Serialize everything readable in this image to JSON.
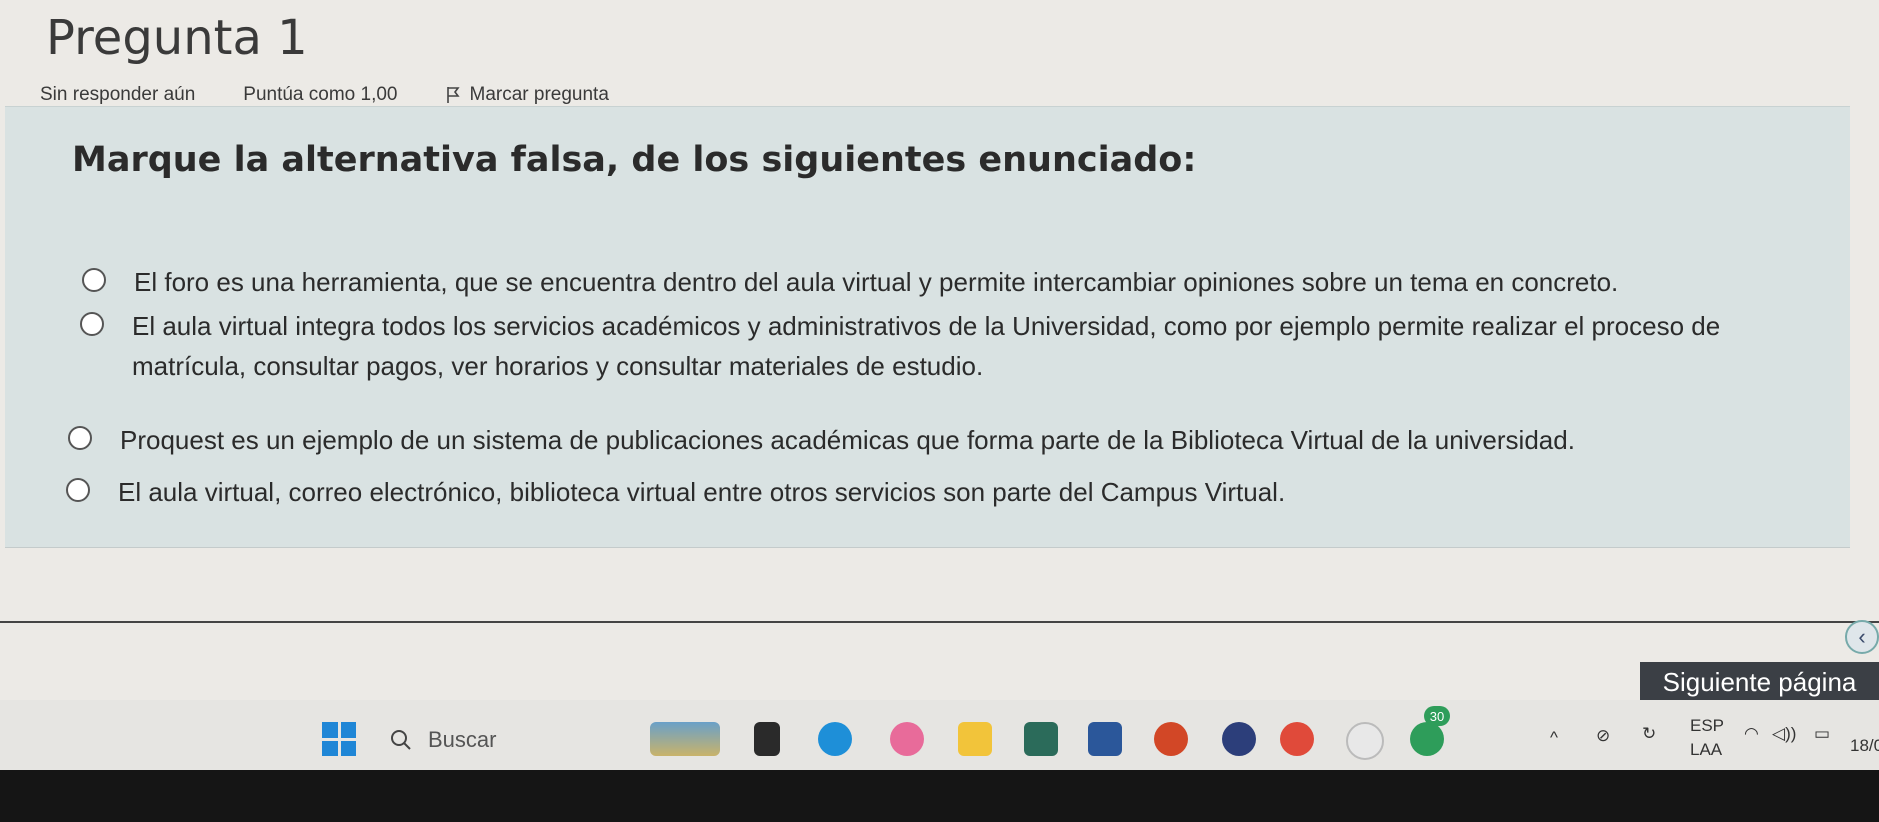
{
  "question": {
    "title": "Pregunta 1",
    "status": "Sin responder aún",
    "score": "Puntúa como 1,00",
    "flag_label": "Marcar pregunta",
    "text": "Marque la alternativa falsa, de los siguientes enunciado:",
    "options": [
      {
        "line1": "El foro es una herramienta, que se encuentra dentro del aula virtual y permite intercambiar opiniones sobre un tema en concreto."
      },
      {
        "line1": "El aula virtual integra todos los servicios académicos y administrativos de la Universidad, como por ejemplo permite realizar el proceso de",
        "line2": "matrícula, consultar pagos, ver horarios y consultar materiales de estudio."
      },
      {
        "line1": "Proquest es un ejemplo de un sistema de publicaciones académicas que forma parte de la Biblioteca Virtual de la universidad."
      },
      {
        "line1": "El aula virtual, correo electrónico, biblioteca virtual entre otros servicios son parte del Campus Virtual."
      }
    ]
  },
  "navigation": {
    "next_label": "Siguiente página"
  },
  "taskbar": {
    "search_placeholder": "Buscar",
    "notification_count": "30",
    "language_top": "ESP",
    "language_bottom": "LAA",
    "date_partial": "18/0",
    "colors": {
      "start": "#1f86d6",
      "edge": "#1e8fd8",
      "chrome": "#e04a3a",
      "word": "#2b579a",
      "powerpoint": "#d24726"
    }
  }
}
